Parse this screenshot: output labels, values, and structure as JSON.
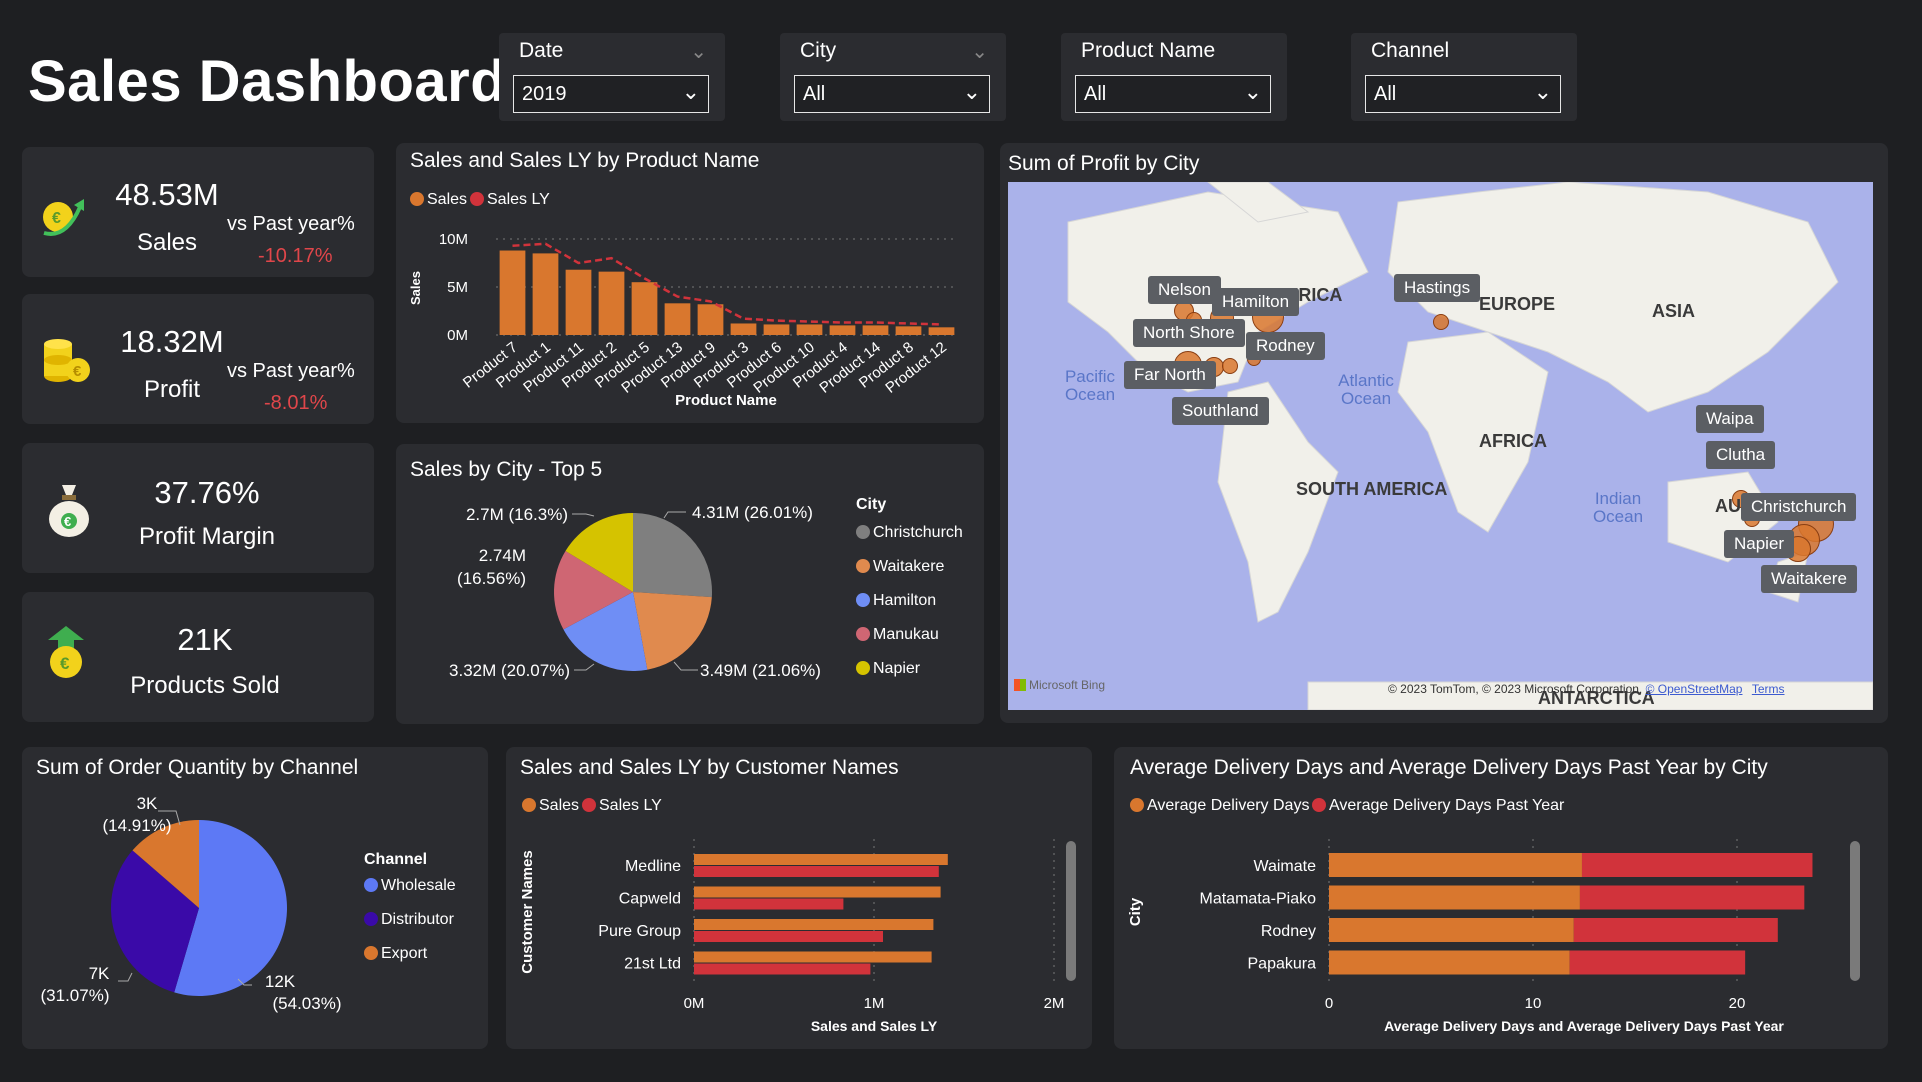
{
  "header": {
    "title": "Sales Dashboard"
  },
  "filters": [
    {
      "label": "Date",
      "value": "2019"
    },
    {
      "label": "City",
      "value": "All"
    },
    {
      "label": "Product Name",
      "value": "All"
    },
    {
      "label": "Channel",
      "value": "All"
    }
  ],
  "kpis": [
    {
      "value": "48.53M",
      "label": "Sales",
      "compare_label": "vs Past year%",
      "compare_value": "-10.17%"
    },
    {
      "value": "18.32M",
      "label": "Profit",
      "compare_label": "vs Past year%",
      "compare_value": "-8.01%"
    },
    {
      "value": "37.76%",
      "label": "Profit Margin"
    },
    {
      "value": "21K",
      "label": "Products Sold"
    }
  ],
  "colors": {
    "sales": "#d9772e",
    "sales_ly": "#d1333b",
    "background": "#1e1f22",
    "card": "#2b2c30",
    "negative": "#e0464a"
  },
  "charts": {
    "product_bar": {
      "title": "Sales and Sales LY by Product Name",
      "legend": [
        "Sales",
        "Sales LY"
      ],
      "ylabel": "Sales",
      "xlabel": "Product Name",
      "yticks": [
        "10M",
        "5M",
        "0M"
      ]
    },
    "city_pie": {
      "title": "Sales by City - Top 5",
      "legend_title": "City",
      "labels": [
        "4.31M (26.01%)",
        "3.49M (21.06%)",
        "3.32M (20.07%)",
        "2.74M",
        "(16.56%)",
        "2.7M (16.3%)"
      ]
    },
    "profit_map": {
      "title": "Sum of Profit by City",
      "cities": [
        "Nelson",
        "Hamilton",
        "North Shore",
        "Rodney",
        "Far North",
        "Southland",
        "Hastings",
        "Waipa",
        "Clutha",
        "Christchurch",
        "Napier",
        "Waitakere"
      ],
      "regions": [
        "NORTH AMERICA",
        "EUROPE",
        "ASIA",
        "AFRICA",
        "SOUTH AMERICA",
        "AUSTRALIA",
        "ANTARCTICA"
      ],
      "oceans": [
        "Pacific Ocean",
        "Atlantic Ocean",
        "Indian Ocean"
      ],
      "attribution": "© 2023 TomTom, © 2023 Microsoft Corporation,",
      "osm": "© OpenStreetMap",
      "terms": "Terms",
      "bing": "Microsoft Bing"
    },
    "channel_pie": {
      "title": "Sum of Order Quantity by Channel",
      "legend_title": "Channel",
      "labels": [
        "3K",
        "(14.91%)",
        "7K",
        "(31.07%)",
        "12K",
        "(54.03%)"
      ]
    },
    "customer_bar": {
      "title": "Sales and Sales LY by Customer Names",
      "legend": [
        "Sales",
        "Sales LY"
      ],
      "ylabel": "Customer Names",
      "xlabel": "Sales and Sales LY",
      "xticks": [
        "0M",
        "1M",
        "2M"
      ]
    },
    "delivery_bar": {
      "title": "Average Delivery Days and Average Delivery Days Past Year by City",
      "legend": [
        "Average Delivery Days",
        "Average Delivery Days Past Year"
      ],
      "ylabel": "City",
      "xlabel": "Average Delivery Days and Average Delivery Days Past Year",
      "xticks": [
        "0",
        "10",
        "20"
      ]
    }
  },
  "chart_data": [
    {
      "type": "bar",
      "title": "Sales and Sales LY by Product Name",
      "categories": [
        "Product 7",
        "Product 1",
        "Product 11",
        "Product 2",
        "Product 5",
        "Product 13",
        "Product 9",
        "Product 3",
        "Product 6",
        "Product 10",
        "Product 4",
        "Product 14",
        "Product 8",
        "Product 12"
      ],
      "series": [
        {
          "name": "Sales",
          "values": [
            8.8,
            8.5,
            6.8,
            6.6,
            5.5,
            3.3,
            3.2,
            1.2,
            1.1,
            1.1,
            1.0,
            1.0,
            0.9,
            0.8
          ]
        },
        {
          "name": "Sales LY",
          "values": [
            9.3,
            9.5,
            7.5,
            8.0,
            5.9,
            4.0,
            3.5,
            1.7,
            1.5,
            1.4,
            1.3,
            1.3,
            1.2,
            1.1
          ]
        }
      ],
      "xlabel": "Product Name",
      "ylabel": "Sales",
      "ylim": [
        0,
        10
      ]
    },
    {
      "type": "pie",
      "title": "Sales by City - Top 5",
      "categories": [
        "Christchurch",
        "Waitakere",
        "Hamilton",
        "Manukau",
        "Napier"
      ],
      "values": [
        4.31,
        3.49,
        3.32,
        2.74,
        2.7
      ],
      "percents": [
        26.01,
        21.06,
        20.07,
        16.56,
        16.3
      ],
      "colors": [
        "#7f7f7f",
        "#e08a4e",
        "#6f8ef5",
        "#cf6673",
        "#d5c300"
      ]
    },
    {
      "type": "pie",
      "title": "Sum of Order Quantity by Channel",
      "categories": [
        "Wholesale",
        "Distributor",
        "Export"
      ],
      "values": [
        12,
        7,
        3
      ],
      "percents": [
        54.03,
        31.07,
        14.91
      ],
      "colors": [
        "#5d79f5",
        "#3a0aa8",
        "#d9772e"
      ]
    },
    {
      "type": "bar",
      "title": "Sales and Sales LY by Customer Names",
      "categories": [
        "Medline",
        "Capweld",
        "Pure Group",
        "21st Ltd"
      ],
      "series": [
        {
          "name": "Sales",
          "values": [
            1.41,
            1.37,
            1.33,
            1.32
          ]
        },
        {
          "name": "Sales LY",
          "values": [
            1.36,
            0.83,
            1.05,
            0.98
          ]
        }
      ],
      "xlabel": "Sales and Sales LY",
      "ylabel": "Customer Names",
      "xlim": [
        0,
        2
      ]
    },
    {
      "type": "bar",
      "title": "Average Delivery Days and Average Delivery Days Past Year by City",
      "categories": [
        "Waimate",
        "Matamata-Piako",
        "Rodney",
        "Papakura"
      ],
      "series": [
        {
          "name": "Average Delivery Days",
          "values": [
            12.4,
            12.3,
            12.0,
            11.8
          ]
        },
        {
          "name": "Average Delivery Days Past Year",
          "values": [
            11.3,
            11.0,
            10.0,
            8.6
          ]
        }
      ],
      "stacked": true,
      "xlabel": "Average Delivery Days and Average Delivery Days Past Year",
      "ylabel": "City",
      "xlim": [
        0,
        25
      ]
    }
  ]
}
